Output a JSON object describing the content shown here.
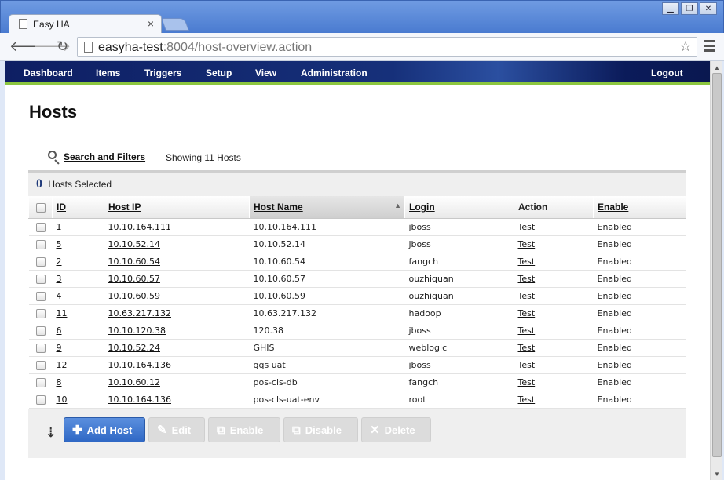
{
  "browser": {
    "tab_title": "Easy HA",
    "tab_close": "×",
    "url_host": "easyha-test",
    "url_rest": ":8004/host-overview.action",
    "window_buttons": [
      "▁",
      "❐",
      "✕"
    ]
  },
  "nav": {
    "items": [
      "Dashboard",
      "Items",
      "Triggers",
      "Setup",
      "View",
      "Administration"
    ],
    "logout": "Logout"
  },
  "page": {
    "title": "Hosts",
    "search_link": "Search and Filters",
    "showing": "Showing 11 Hosts",
    "selected_count": "0",
    "selected_label": "Hosts Selected"
  },
  "table": {
    "columns": [
      "ID",
      "Host IP",
      "Host Name",
      "Login",
      "Action",
      "Enable"
    ],
    "sorted_column": "Host Name",
    "rows": [
      {
        "id": "1",
        "ip": "10.10.164.111",
        "name": "10.10.164.111",
        "login": "jboss",
        "action": "Test",
        "enable": "Enabled"
      },
      {
        "id": "5",
        "ip": "10.10.52.14",
        "name": "10.10.52.14",
        "login": "jboss",
        "action": "Test",
        "enable": "Enabled"
      },
      {
        "id": "2",
        "ip": "10.10.60.54",
        "name": "10.10.60.54",
        "login": "fangch",
        "action": "Test",
        "enable": "Enabled"
      },
      {
        "id": "3",
        "ip": "10.10.60.57",
        "name": "10.10.60.57",
        "login": "ouzhiquan",
        "action": "Test",
        "enable": "Enabled"
      },
      {
        "id": "4",
        "ip": "10.10.60.59",
        "name": "10.10.60.59",
        "login": "ouzhiquan",
        "action": "Test",
        "enable": "Enabled"
      },
      {
        "id": "11",
        "ip": "10.63.217.132",
        "name": "10.63.217.132",
        "login": "hadoop",
        "action": "Test",
        "enable": "Enabled"
      },
      {
        "id": "6",
        "ip": "10.10.120.38",
        "name": "120.38",
        "login": "jboss",
        "action": "Test",
        "enable": "Enabled"
      },
      {
        "id": "9",
        "ip": "10.10.52.24",
        "name": "GHIS",
        "login": "weblogic",
        "action": "Test",
        "enable": "Enabled"
      },
      {
        "id": "12",
        "ip": "10.10.164.136",
        "name": "gqs uat",
        "login": "jboss",
        "action": "Test",
        "enable": "Enabled"
      },
      {
        "id": "8",
        "ip": "10.10.60.12",
        "name": "pos-cls-db",
        "login": "fangch",
        "action": "Test",
        "enable": "Enabled"
      },
      {
        "id": "10",
        "ip": "10.10.164.136",
        "name": "pos-cls-uat-env",
        "login": "root",
        "action": "Test",
        "enable": "Enabled"
      }
    ]
  },
  "buttons": {
    "add_host": "Add Host",
    "edit": "Edit",
    "enable": "Enable",
    "disable": "Disable",
    "delete": "Delete"
  },
  "colors": {
    "nav_bg": "#16307a",
    "nav_accent": "#8cc63f",
    "primary_button": "#2f68c5",
    "disabled_button": "#dcdcdc"
  }
}
